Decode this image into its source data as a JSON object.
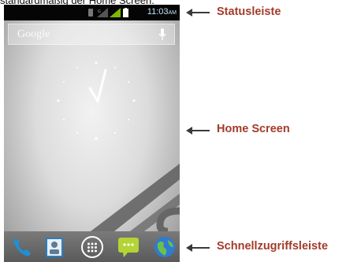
{
  "caption": "standardmäßig der Home Screen.",
  "status_bar": {
    "time": "11:03",
    "ampm": "AM"
  },
  "search": {
    "label": "Google"
  },
  "annotations": {
    "status": "Statusleiste",
    "home": "Home Screen",
    "dock": "Schnellzugriffsleiste"
  },
  "dock_items": [
    "phone-icon",
    "contacts-icon",
    "app-drawer-icon",
    "messaging-icon",
    "browser-icon"
  ],
  "colors": {
    "annotation": "#a33b2a",
    "time": "#bfe6ff"
  }
}
